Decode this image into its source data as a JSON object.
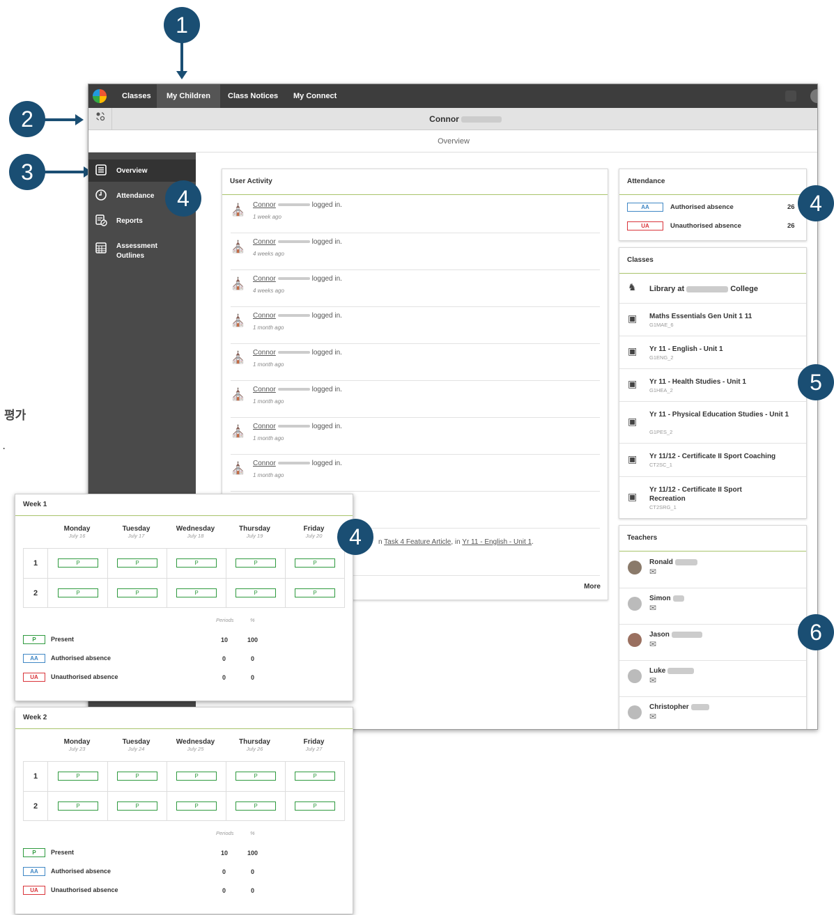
{
  "nav": {
    "tabs": [
      {
        "label": "Classes"
      },
      {
        "label": "My Children"
      },
      {
        "label": "Class Notices"
      },
      {
        "label": "My Connect"
      }
    ]
  },
  "child": {
    "name": "Connor"
  },
  "page": {
    "title": "Overview"
  },
  "sidebar": {
    "items": [
      {
        "label": "Overview"
      },
      {
        "label": "Attendance"
      },
      {
        "label": "Reports"
      },
      {
        "label": "Assessment Outlines"
      }
    ]
  },
  "activity": {
    "title": "User Activity",
    "items": [
      {
        "name": "Connor",
        "action": "logged in.",
        "ago": "1 week ago"
      },
      {
        "name": "Connor",
        "action": "logged in.",
        "ago": "4 weeks ago"
      },
      {
        "name": "Connor",
        "action": "logged in.",
        "ago": "4 weeks ago"
      },
      {
        "name": "Connor",
        "action": "logged in.",
        "ago": "1 month ago"
      },
      {
        "name": "Connor",
        "action": "logged in.",
        "ago": "1 month ago"
      },
      {
        "name": "Connor",
        "action": "logged in.",
        "ago": "1 month ago"
      },
      {
        "name": "Connor",
        "action": "logged in.",
        "ago": "1 month ago"
      },
      {
        "name": "Connor",
        "action": "logged in.",
        "ago": "1 month ago"
      }
    ],
    "submission_prefix": "n",
    "submission_link": "Task 4 Feature Article",
    "submission_mid": ", in",
    "submission_class": "Yr 11 - English - Unit 1",
    "submission_end": ".",
    "more_label": "More"
  },
  "attendance": {
    "title": "Attendance",
    "rows": [
      {
        "code": "AA",
        "label": "Authorised absence",
        "count": "26"
      },
      {
        "code": "UA",
        "label": "Unauthorised absence",
        "count": "26"
      }
    ]
  },
  "classes": {
    "title": "Classes",
    "library_prefix": "Library at",
    "library_suffix": "College",
    "items": [
      {
        "title": "Maths Essentials Gen Unit 1 11",
        "code": "G1MAE_6"
      },
      {
        "title": "Yr 11 - English - Unit 1",
        "code": "G1ENG_2"
      },
      {
        "title": "Yr 11 - Health Studies - Unit 1",
        "code": "G1HEA_2"
      },
      {
        "title": "Yr 11 - Physical Education Studies - Unit 1",
        "code": "G1PES_2"
      },
      {
        "title": "Yr 11/12 - Certificate II Sport Coaching",
        "code": "CT2SC_1"
      },
      {
        "title": "Yr 11/12 - Certificate II Sport Recreation",
        "code": "CT2SRG_1"
      }
    ]
  },
  "teachers": {
    "title": "Teachers",
    "items": [
      {
        "name": "Ronald"
      },
      {
        "name": "Simon"
      },
      {
        "name": "Jason"
      },
      {
        "name": "Luke"
      },
      {
        "name": "Christopher"
      }
    ]
  },
  "callouts": [
    "1",
    "2",
    "3",
    "4",
    "4",
    "4",
    "5",
    "6"
  ],
  "side_text": {
    "korean": "평가",
    "dot": "."
  },
  "weeks": [
    {
      "title": "Week 1",
      "days": [
        {
          "name": "Monday",
          "date": "July 16"
        },
        {
          "name": "Tuesday",
          "date": "July 17"
        },
        {
          "name": "Wednesday",
          "date": "July 18"
        },
        {
          "name": "Thursday",
          "date": "July 19"
        },
        {
          "name": "Friday",
          "date": "July 20"
        }
      ],
      "periods": [
        "1",
        "2"
      ],
      "mark": "P",
      "col_periods": "Periods",
      "col_pct": "%",
      "legend": [
        {
          "code": "P",
          "label": "Present",
          "periods": "10",
          "pct": "100"
        },
        {
          "code": "AA",
          "label": "Authorised absence",
          "periods": "0",
          "pct": "0"
        },
        {
          "code": "UA",
          "label": "Unauthorised absence",
          "periods": "0",
          "pct": "0"
        }
      ]
    },
    {
      "title": "Week 2",
      "days": [
        {
          "name": "Monday",
          "date": "July 23"
        },
        {
          "name": "Tuesday",
          "date": "July 24"
        },
        {
          "name": "Wednesday",
          "date": "July 25"
        },
        {
          "name": "Thursday",
          "date": "July 26"
        },
        {
          "name": "Friday",
          "date": "July 27"
        }
      ],
      "periods": [
        "1",
        "2"
      ],
      "mark": "P",
      "col_periods": "Periods",
      "col_pct": "%",
      "legend": [
        {
          "code": "P",
          "label": "Present",
          "periods": "10",
          "pct": "100"
        },
        {
          "code": "AA",
          "label": "Authorised absence",
          "periods": "0",
          "pct": "0"
        },
        {
          "code": "UA",
          "label": "Unauthorised absence",
          "periods": "0",
          "pct": "0"
        }
      ]
    }
  ],
  "colors": {
    "nav_bg": "#3d3d3d",
    "sidebar_bg": "#4a4a4a",
    "accent_line": "#a8c36a",
    "callout": "#1a4e73",
    "present": "#2e9a3e",
    "authorised": "#3f87c5",
    "unauthorised": "#d9343a"
  }
}
